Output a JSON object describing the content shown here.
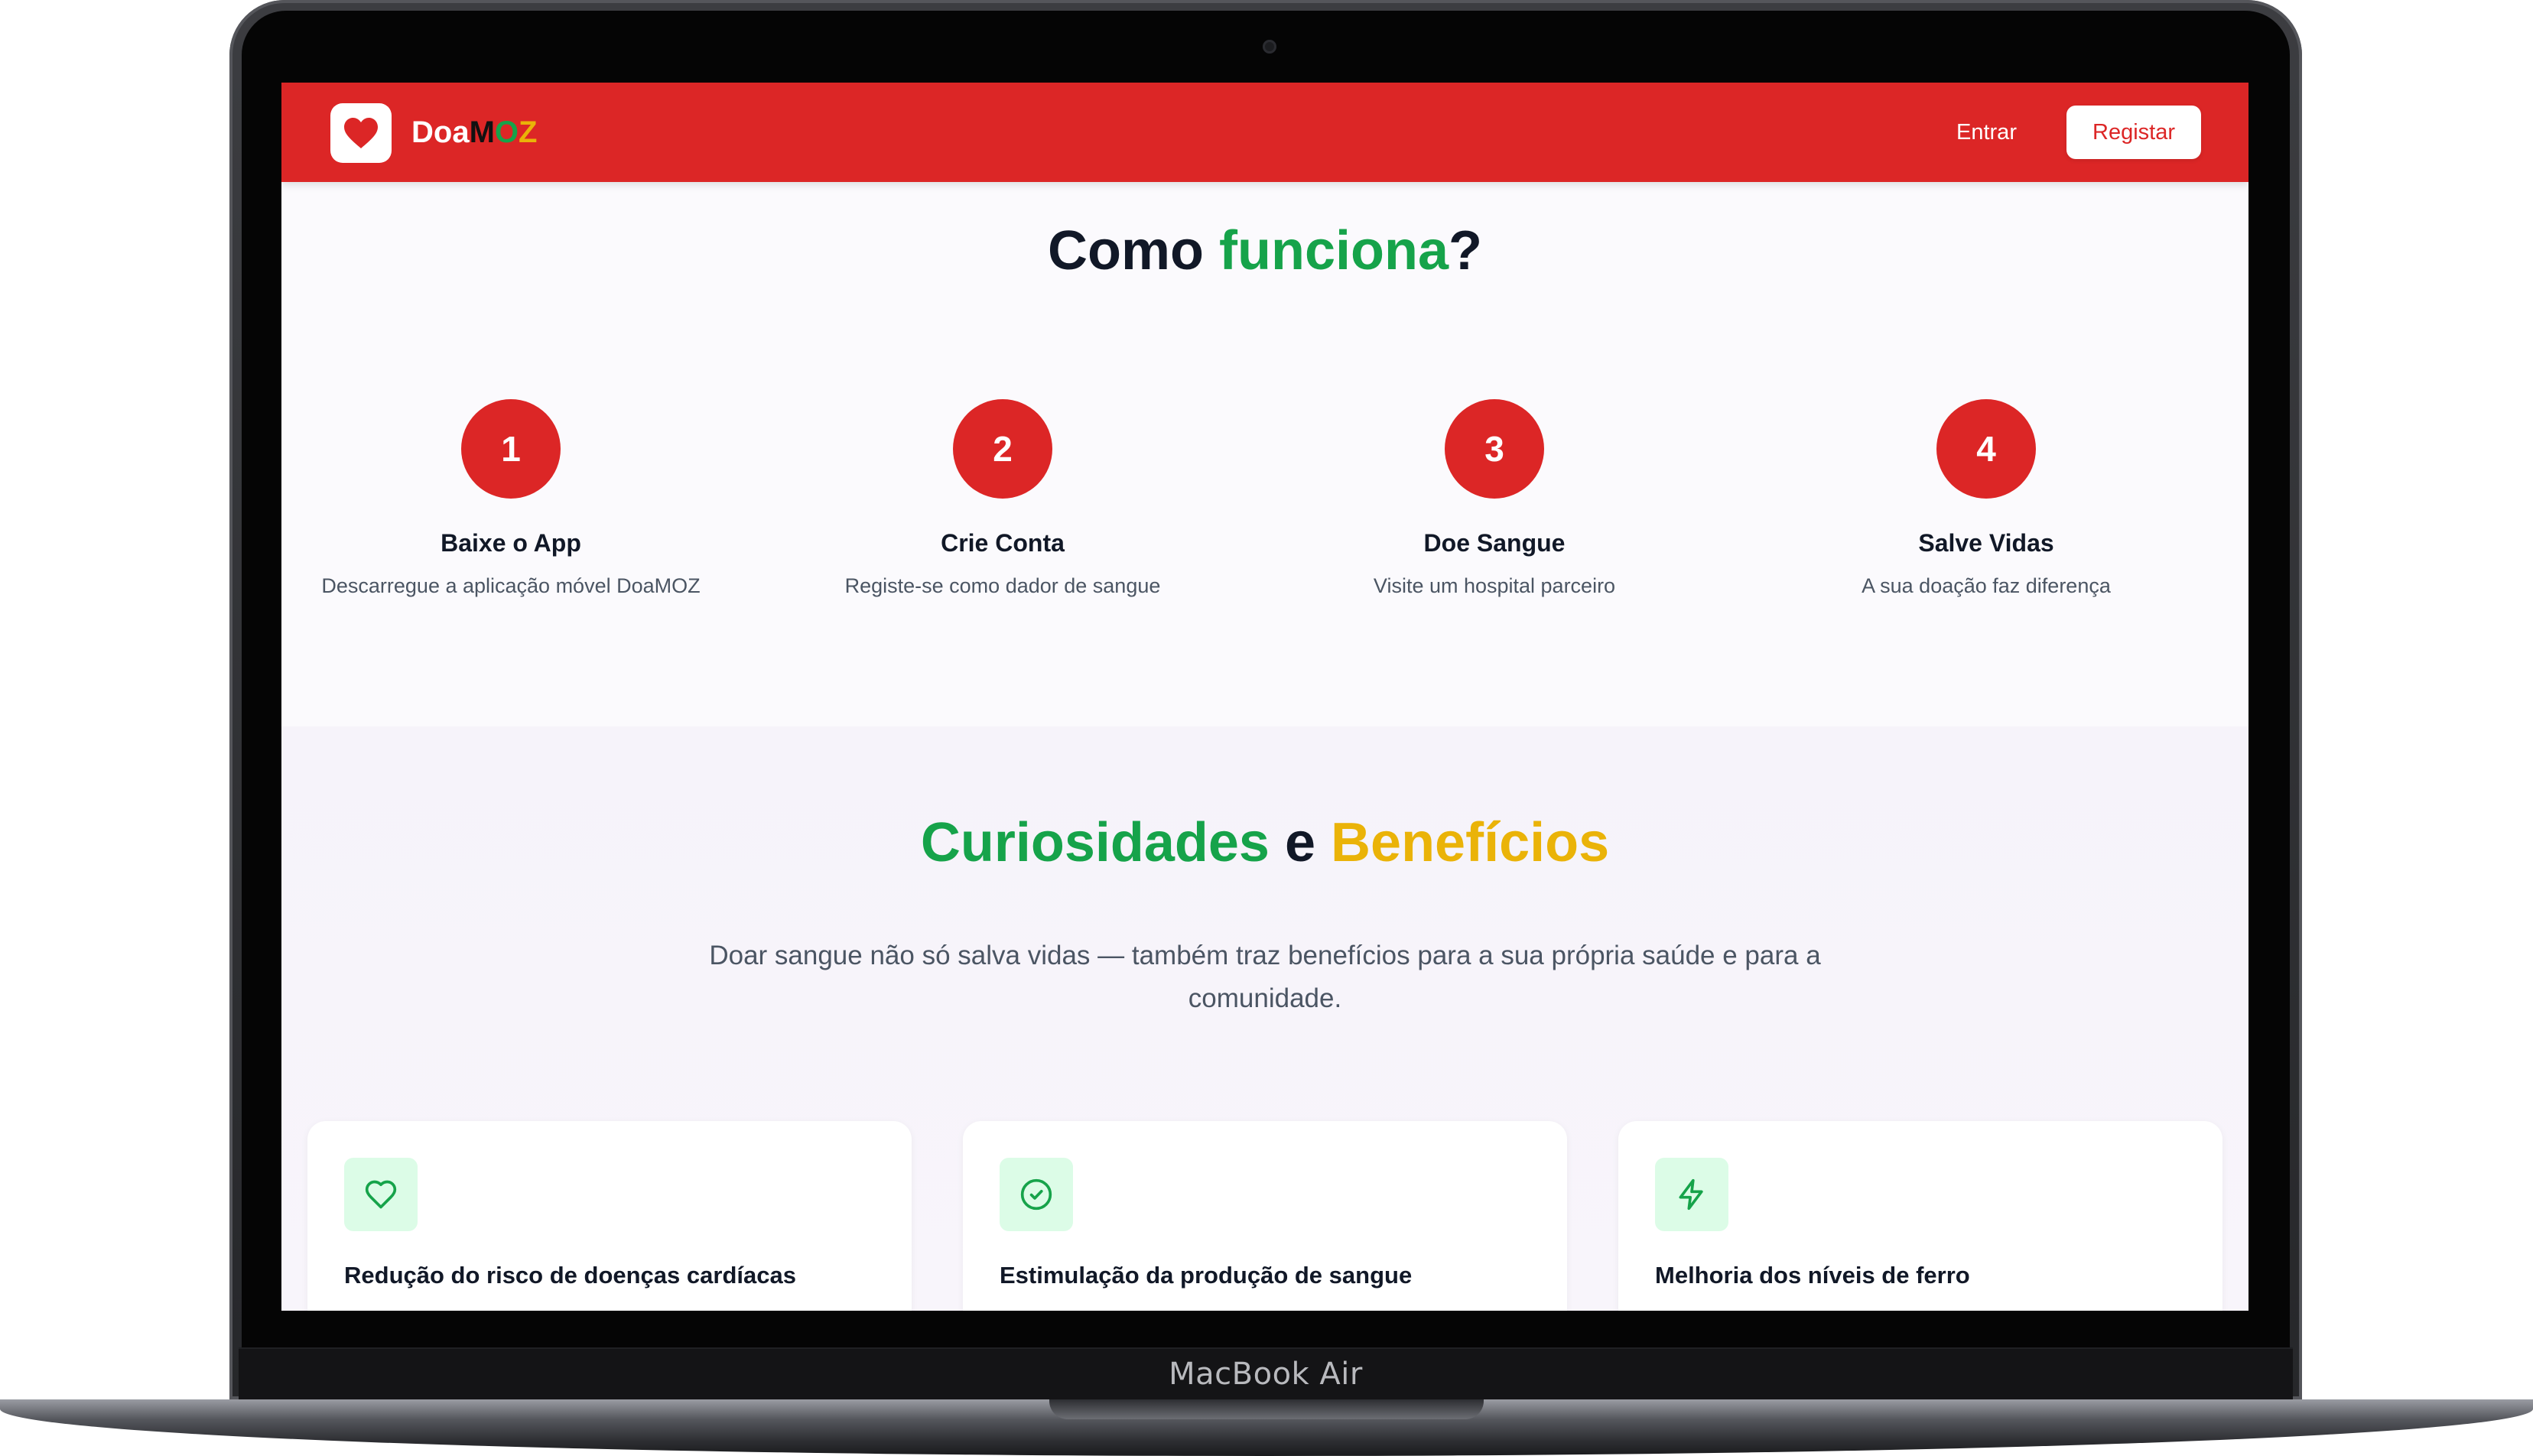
{
  "device": {
    "label": "MacBook Air"
  },
  "navbar": {
    "logo_icon": "heart-icon",
    "brand_prefix": "Doa",
    "brand_m": "M",
    "brand_o": "O",
    "brand_z": "Z",
    "login_label": "Entrar",
    "register_label": "Registar",
    "color": "#dc2626"
  },
  "how_it_works": {
    "title_start": "Como ",
    "title_highlight": "funciona",
    "title_end": "?",
    "steps": [
      {
        "number": "1",
        "title": "Baixe o App",
        "description": "Descarregue a aplicação móvel DoaMOZ"
      },
      {
        "number": "2",
        "title": "Crie Conta",
        "description": "Registe-se como dador de sangue"
      },
      {
        "number": "3",
        "title": "Doe Sangue",
        "description": "Visite um hospital parceiro"
      },
      {
        "number": "4",
        "title": "Salve Vidas",
        "description": "A sua doação faz diferença"
      }
    ]
  },
  "benefits": {
    "title_part1": "Curiosidades",
    "title_part2": " e ",
    "title_part3": "Benefícios",
    "subtitle": "Doar sangue não só salva vidas — também traz benefícios para a sua própria saúde e para a comunidade.",
    "cards": [
      {
        "icon": "heart-icon",
        "title": "Redução do risco de doenças cardíacas"
      },
      {
        "icon": "check-circle-icon",
        "title": "Estimulação da produção de sangue"
      },
      {
        "icon": "lightning-icon",
        "title": "Melhoria dos níveis de ferro"
      }
    ]
  },
  "colors": {
    "primary_red": "#dc2626",
    "green": "#16a34a",
    "yellow": "#eab308",
    "icon_bg": "#dcfce7"
  }
}
